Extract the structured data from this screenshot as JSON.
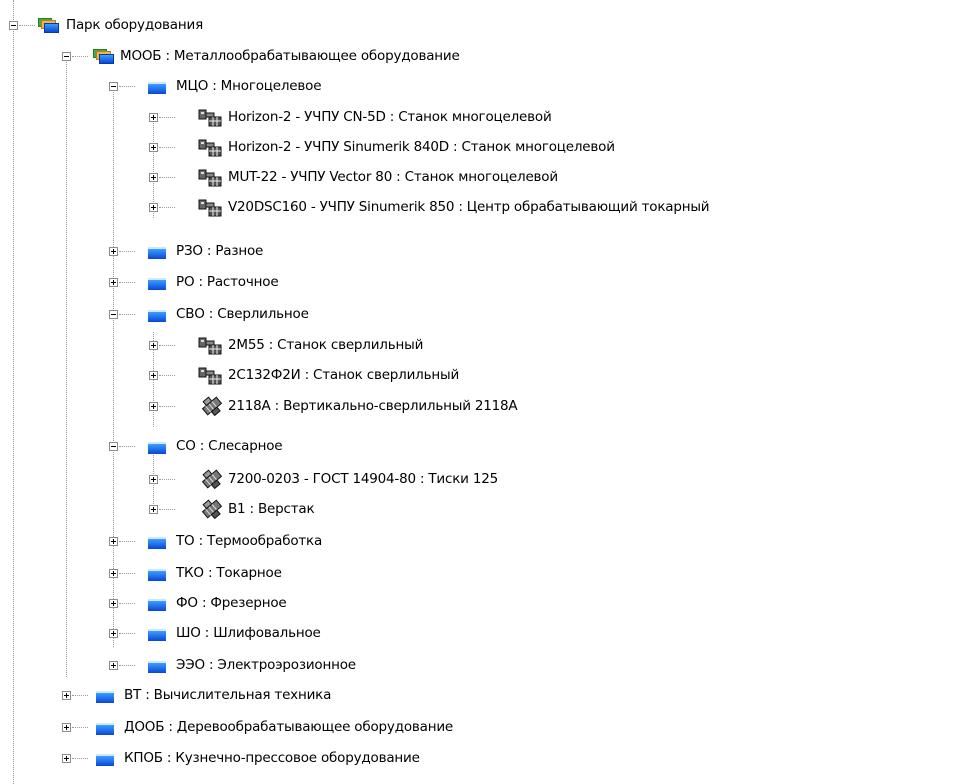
{
  "tree": {
    "nodes": [
      {
        "label": "Парк оборудования",
        "depth": 0,
        "state": "expanded",
        "icon": "group-folder-icon"
      },
      {
        "label": "МООБ : Металлообрабатывающее оборудование",
        "depth": 1,
        "state": "expanded",
        "icon": "group-folder-icon"
      },
      {
        "label": "МЦО : Многоцелевое",
        "depth": 2,
        "state": "expanded",
        "icon": "folder-icon"
      },
      {
        "label": "Horizon-2 - УЧПУ CN-5D : Станок многоцелевой",
        "depth": 3,
        "state": "collapsed",
        "icon": "machine-icon"
      },
      {
        "label": "Horizon-2 - УЧПУ Sinumerik 840D : Станок многоцелевой",
        "depth": 3,
        "state": "collapsed",
        "icon": "machine-icon"
      },
      {
        "label": "MUT-22 - УЧПУ Vector 80 : Станок многоцелевой",
        "depth": 3,
        "state": "collapsed",
        "icon": "machine-icon"
      },
      {
        "label": "V20DSC160 - УЧПУ Sinumerik 850 : Центр обрабатывающий токарный",
        "depth": 3,
        "state": "collapsed",
        "icon": "machine-icon"
      },
      {
        "label": "РЗО : Разное",
        "depth": 2,
        "state": "collapsed",
        "icon": "folder-icon"
      },
      {
        "label": "РО : Расточное",
        "depth": 2,
        "state": "collapsed",
        "icon": "folder-icon"
      },
      {
        "label": "СВО : Сверлильное",
        "depth": 2,
        "state": "expanded",
        "icon": "folder-icon"
      },
      {
        "label": "2М55 : Станок сверлильный",
        "depth": 3,
        "state": "collapsed",
        "icon": "machine-icon"
      },
      {
        "label": "2С132Ф2И : Станок сверлильный",
        "depth": 3,
        "state": "collapsed",
        "icon": "machine-icon"
      },
      {
        "label": "2118А : Вертикально-сверлильный 2118А",
        "depth": 3,
        "state": "collapsed",
        "icon": "tool-icon"
      },
      {
        "label": "СО : Слесарное",
        "depth": 2,
        "state": "expanded",
        "icon": "folder-icon"
      },
      {
        "label": "7200-0203 - ГОСТ 14904-80 : Тиски 125",
        "depth": 3,
        "state": "collapsed",
        "icon": "tool-icon"
      },
      {
        "label": "В1 : Верстак",
        "depth": 3,
        "state": "collapsed",
        "icon": "tool-icon"
      },
      {
        "label": "ТО : Термообработка",
        "depth": 2,
        "state": "collapsed",
        "icon": "folder-icon"
      },
      {
        "label": "ТКО : Токарное",
        "depth": 2,
        "state": "collapsed",
        "icon": "folder-icon"
      },
      {
        "label": "ФО : Фрезерное",
        "depth": 2,
        "state": "collapsed",
        "icon": "folder-icon"
      },
      {
        "label": "ШО : Шлифовальное",
        "depth": 2,
        "state": "collapsed",
        "icon": "folder-icon"
      },
      {
        "label": "ЭЭО : Электроэрозионное",
        "depth": 2,
        "state": "collapsed",
        "icon": "folder-icon"
      },
      {
        "label": "ВТ : Вычислительная техника",
        "depth": 1,
        "state": "collapsed",
        "icon": "folder-icon"
      },
      {
        "label": "ДООБ : Деревообрабатывающее оборудование",
        "depth": 1,
        "state": "collapsed",
        "icon": "folder-icon"
      },
      {
        "label": "КПОБ : Кузнечно-прессовое оборудование",
        "depth": 1,
        "state": "collapsed",
        "icon": "folder-icon"
      }
    ]
  },
  "colors": {
    "folder_blue": "#0a46d6",
    "tree_lines": "#9a9a9a"
  }
}
